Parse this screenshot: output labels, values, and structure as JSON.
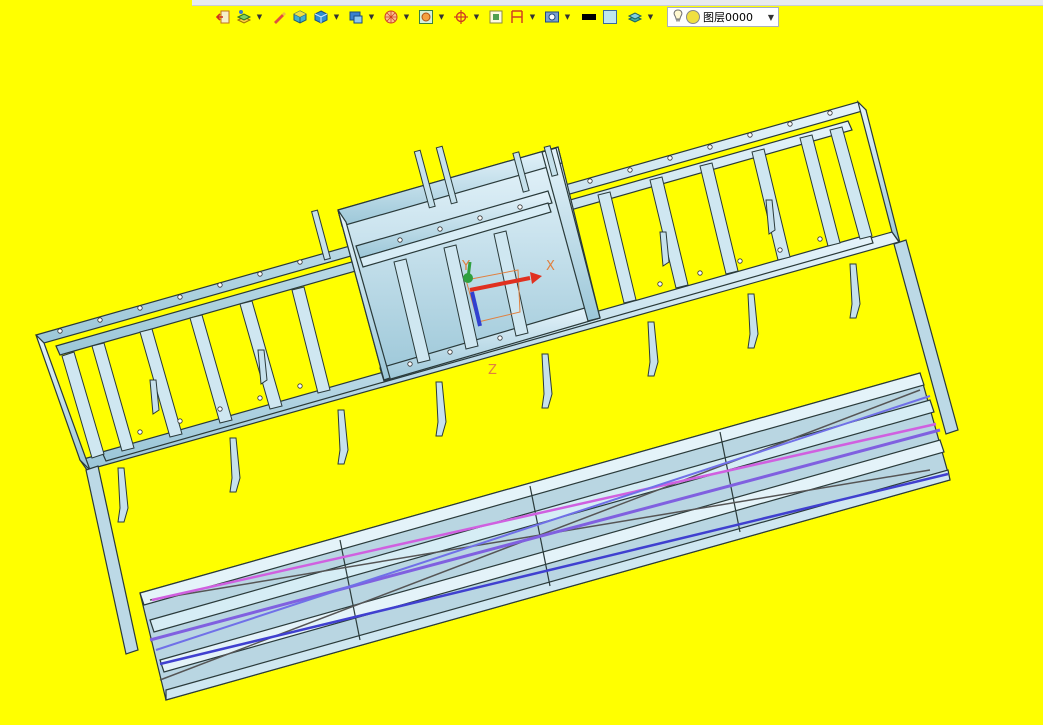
{
  "toolbar": {
    "layer_name": "图层0000",
    "buttons": [
      {
        "name": "exit-sketch-icon",
        "dropdown": false
      },
      {
        "name": "layer-manager-icon",
        "dropdown": true
      },
      {
        "name": "pencil-icon",
        "dropdown": false
      },
      {
        "name": "shaded-solid-icon",
        "dropdown": false
      },
      {
        "name": "cube-view-icon",
        "dropdown": true
      },
      {
        "name": "display-mode-icon",
        "dropdown": true
      },
      {
        "name": "render-style-icon",
        "dropdown": true
      },
      {
        "name": "zoom-fit-icon",
        "dropdown": true
      },
      {
        "name": "snap-point-icon",
        "dropdown": true
      },
      {
        "name": "grid-view-icon",
        "dropdown": false
      },
      {
        "name": "dimension-icon",
        "dropdown": true
      },
      {
        "name": "screen-capture-icon",
        "dropdown": true
      }
    ],
    "line_color": "#000000",
    "fill_color": "#bfe6f0"
  },
  "viewport": {
    "background": "#ffff00",
    "axis_labels": {
      "x": "X",
      "y": "Y",
      "z": "Z"
    }
  }
}
